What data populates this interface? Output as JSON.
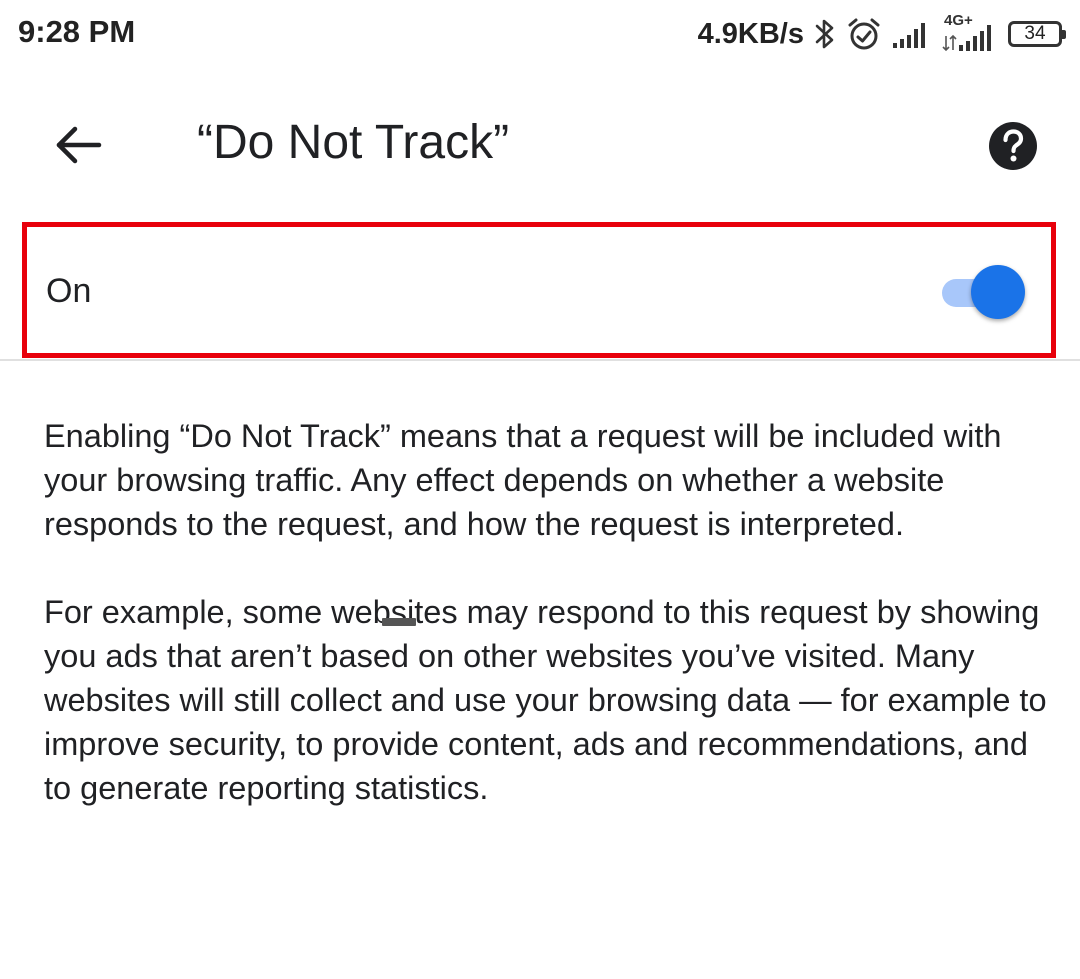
{
  "status_bar": {
    "time": "9:28 PM",
    "net_speed": "4.9KB/s",
    "network_type": "4G+",
    "battery_level": "34",
    "icons": [
      "bluetooth-icon",
      "alarm-icon",
      "signal-icon",
      "signal-4g-icon",
      "battery-icon"
    ]
  },
  "app_bar": {
    "title": "“Do Not Track”",
    "back_icon": "arrow-back-icon",
    "help_icon": "help-icon"
  },
  "setting": {
    "label": "On",
    "enabled": true,
    "accent_color": "#1a73e8",
    "highlight_color": "#e8000b"
  },
  "description": {
    "paragraph_1": "Enabling “Do Not Track” means that a request will be included with your browsing traffic. Any effect depends on whether a website responds to the request, and how the request is interpreted.",
    "paragraph_2": "For example, some websites may respond to this request by showing you ads that aren’t based on other websites you’ve visited. Many websites will still collect and use your browsing data — for example to improve security, to provide content, ads and recommendations, and to generate reporting statistics."
  }
}
